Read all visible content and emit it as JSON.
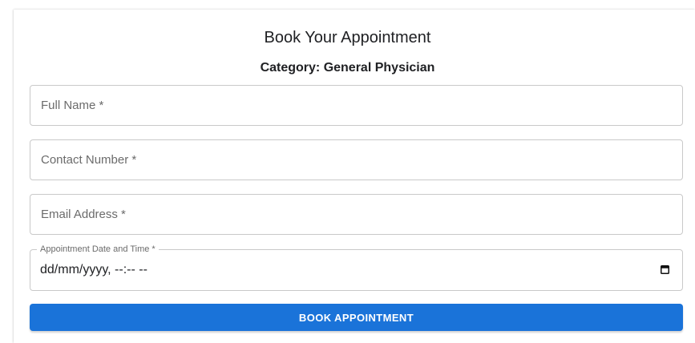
{
  "form": {
    "title": "Book Your Appointment",
    "category": "Category: General Physician",
    "fields": {
      "full_name": {
        "placeholder": "Full Name *",
        "value": ""
      },
      "contact_number": {
        "placeholder": "Contact Number *",
        "value": ""
      },
      "email": {
        "placeholder": "Email Address *",
        "value": ""
      },
      "appointment_datetime": {
        "label": "Appointment Date and Time *",
        "value": "dd/mm/yyyy, --:-- --",
        "icon": "calendar-icon"
      }
    },
    "submit_label": "BOOK APPOINTMENT"
  },
  "colors": {
    "primary": "#1a73d9",
    "border": "#c9c9c9",
    "text": "#202124",
    "placeholder": "#6b6b6b"
  }
}
